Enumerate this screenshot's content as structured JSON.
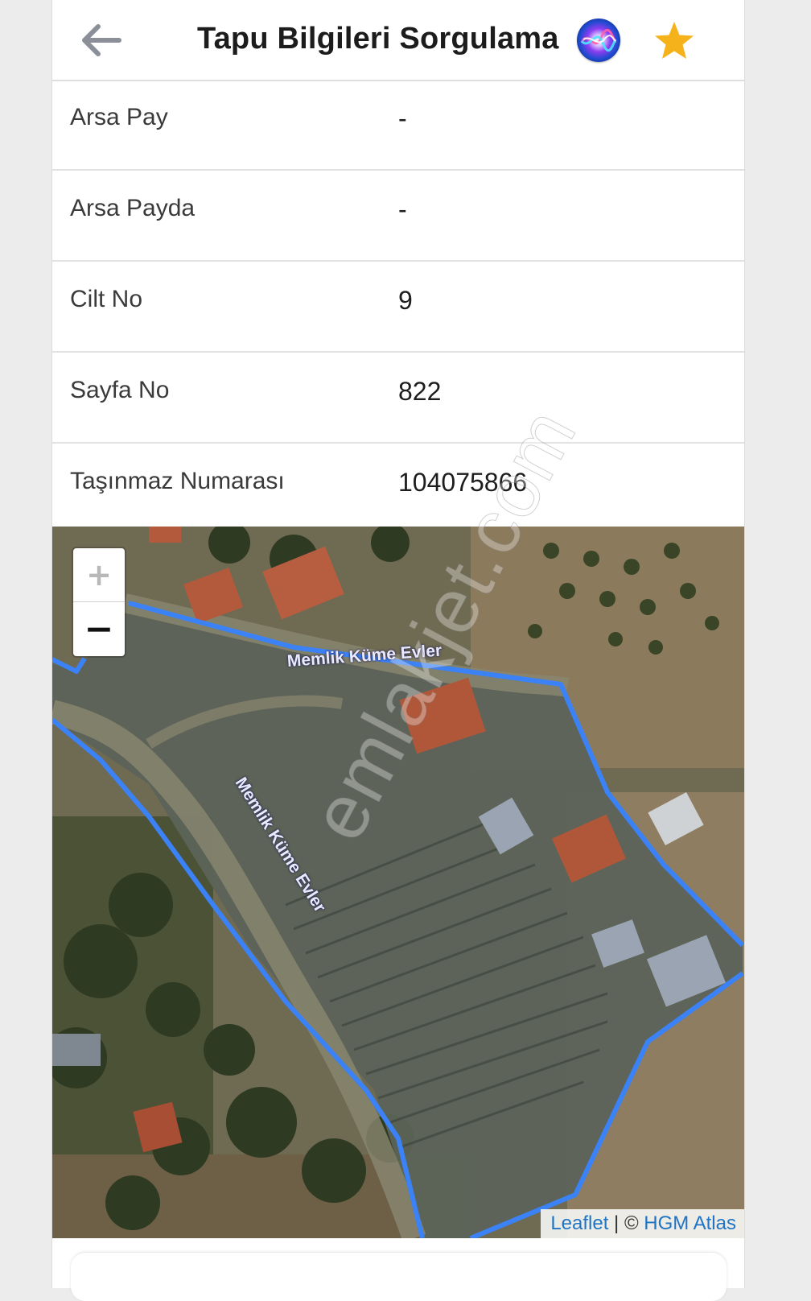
{
  "header": {
    "title": "Tapu Bilgileri Sorgulama",
    "back_icon": "arrow-left-icon",
    "siri_icon": "siri-icon",
    "favorite_icon": "star-icon",
    "star_color": "#f6b21b"
  },
  "rows": [
    {
      "label": "Arsa Pay",
      "value": "-"
    },
    {
      "label": "Arsa Payda",
      "value": "-"
    },
    {
      "label": "Cilt No",
      "value": "9"
    },
    {
      "label": "Sayfa No",
      "value": "822"
    },
    {
      "label": "Taşınmaz Numarası",
      "value": "104075866"
    }
  ],
  "map": {
    "zoom_in_label": "+",
    "zoom_out_label": "−",
    "road_labels": [
      "Memlik Küme Evler",
      "Memlik Küme Evler"
    ],
    "attribution": {
      "leaflet": "Leaflet",
      "separator": " | © ",
      "provider": "HGM Atlas"
    },
    "parcel_color": "#3b82f6"
  },
  "watermark": "emlakjet.com"
}
